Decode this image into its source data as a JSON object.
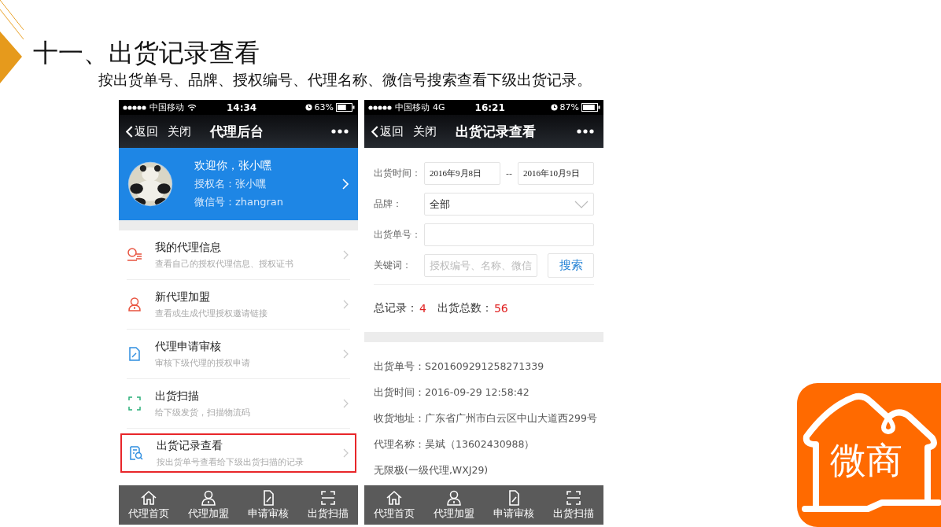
{
  "slide": {
    "title": "十一、出货记录查看",
    "subtitle": "按出货单号、品牌、授权编号、代理名称、微信号搜索查看下级出货记录。"
  },
  "home_screen": {
    "status_bar": {
      "carrier": "中国移动",
      "wifi": true,
      "time": "14:34",
      "battery": "63%"
    },
    "nav_bar": {
      "back": "返回",
      "close": "关闭",
      "title": "代理后台"
    },
    "profile": {
      "greeting": "欢迎你，张小嘿",
      "auth_name": "授权名：张小嘿",
      "wechat": "微信号：zhangran"
    },
    "menu": [
      {
        "title": "我的代理信息",
        "subtitle": "查看自己的授权代理信息、授权证书",
        "selected": false
      },
      {
        "title": "新代理加盟",
        "subtitle": "查看或生成代理授权邀请链接",
        "selected": false
      },
      {
        "title": "代理申请审核",
        "subtitle": "审核下级代理的授权申请",
        "selected": false
      },
      {
        "title": "出货扫描",
        "subtitle": "给下级发货，扫描物流码",
        "selected": false
      },
      {
        "title": "出货记录查看",
        "subtitle": "按出货单号查看给下级出货扫描的记录",
        "selected": true
      }
    ],
    "tab_bar": [
      "代理首页",
      "代理加盟",
      "申请审核",
      "出货扫描"
    ]
  },
  "records_screen": {
    "status_bar": {
      "carrier": "中国移动",
      "network": "4G",
      "time": "16:21",
      "battery": "87%"
    },
    "nav_bar": {
      "back": "返回",
      "close": "关闭",
      "title": "出货记录查看"
    },
    "filters": {
      "time_label": "出货时间：",
      "date_from": "2016年9月8日",
      "separator": "--",
      "date_to": "2016年10月9日",
      "brand_label": "品牌：",
      "brand_value": "全部",
      "order_label": "出货单号：",
      "keyword_label": "关键词：",
      "keyword_placeholder": "授权编号、名称、微信",
      "search_button": "搜索"
    },
    "summary": {
      "total_label": "总记录：",
      "total": "4",
      "quantity_label": "出货总数：",
      "quantity": "56"
    },
    "record": [
      "出货单号：S201609291258271339",
      "出货时间：2016-09-29 12:58:42",
      "收货地址：广东省广州市白云区中山大道西299号",
      "代理名称：吴斌（13602430988）",
      "无限极(一级代理,WXJ29)"
    ],
    "tab_bar": [
      "代理首页",
      "代理加盟",
      "申请审核",
      "出货扫描"
    ]
  },
  "logo": {
    "text": "微商"
  }
}
